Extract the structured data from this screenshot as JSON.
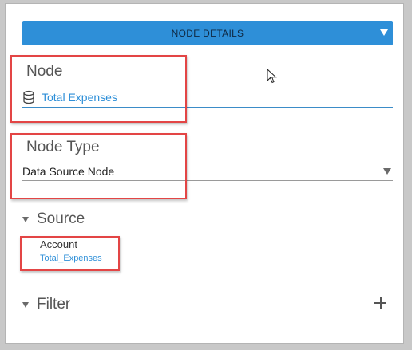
{
  "header": {
    "title": "NODE DETAILS"
  },
  "node": {
    "label": "Node",
    "value": "Total Expenses",
    "icon": "database-icon"
  },
  "node_type": {
    "label": "Node Type",
    "value": "Data Source Node"
  },
  "source": {
    "label": "Source",
    "account_label": "Account",
    "account_value": "Total_Expenses"
  },
  "filter": {
    "label": "Filter",
    "add_icon": "plus-icon"
  },
  "colors": {
    "accent": "#2e8fd8",
    "highlight": "#e34545"
  }
}
